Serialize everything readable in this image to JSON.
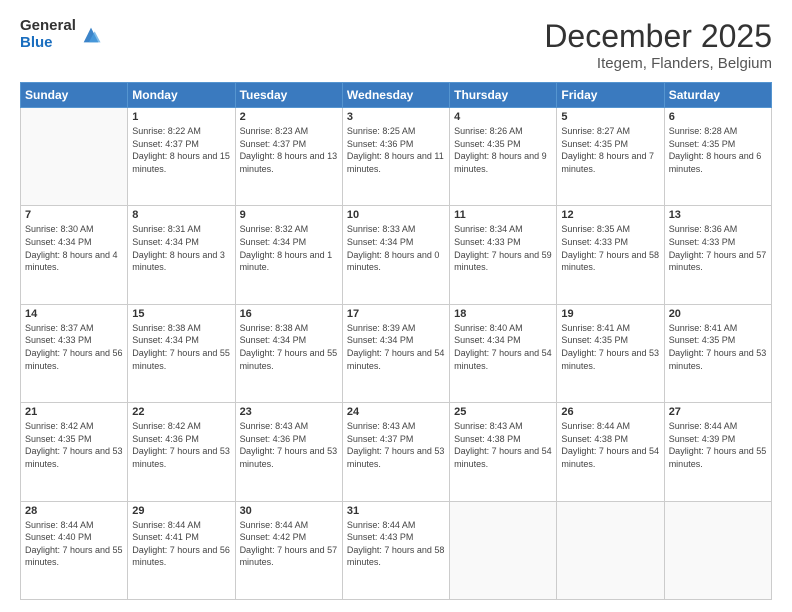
{
  "logo": {
    "general": "General",
    "blue": "Blue"
  },
  "header": {
    "month": "December 2025",
    "location": "Itegem, Flanders, Belgium"
  },
  "days": [
    "Sunday",
    "Monday",
    "Tuesday",
    "Wednesday",
    "Thursday",
    "Friday",
    "Saturday"
  ],
  "weeks": [
    [
      {
        "day": "",
        "sunrise": "",
        "sunset": "",
        "daylight": ""
      },
      {
        "day": "1",
        "sunrise": "Sunrise: 8:22 AM",
        "sunset": "Sunset: 4:37 PM",
        "daylight": "Daylight: 8 hours and 15 minutes."
      },
      {
        "day": "2",
        "sunrise": "Sunrise: 8:23 AM",
        "sunset": "Sunset: 4:37 PM",
        "daylight": "Daylight: 8 hours and 13 minutes."
      },
      {
        "day": "3",
        "sunrise": "Sunrise: 8:25 AM",
        "sunset": "Sunset: 4:36 PM",
        "daylight": "Daylight: 8 hours and 11 minutes."
      },
      {
        "day": "4",
        "sunrise": "Sunrise: 8:26 AM",
        "sunset": "Sunset: 4:35 PM",
        "daylight": "Daylight: 8 hours and 9 minutes."
      },
      {
        "day": "5",
        "sunrise": "Sunrise: 8:27 AM",
        "sunset": "Sunset: 4:35 PM",
        "daylight": "Daylight: 8 hours and 7 minutes."
      },
      {
        "day": "6",
        "sunrise": "Sunrise: 8:28 AM",
        "sunset": "Sunset: 4:35 PM",
        "daylight": "Daylight: 8 hours and 6 minutes."
      }
    ],
    [
      {
        "day": "7",
        "sunrise": "Sunrise: 8:30 AM",
        "sunset": "Sunset: 4:34 PM",
        "daylight": "Daylight: 8 hours and 4 minutes."
      },
      {
        "day": "8",
        "sunrise": "Sunrise: 8:31 AM",
        "sunset": "Sunset: 4:34 PM",
        "daylight": "Daylight: 8 hours and 3 minutes."
      },
      {
        "day": "9",
        "sunrise": "Sunrise: 8:32 AM",
        "sunset": "Sunset: 4:34 PM",
        "daylight": "Daylight: 8 hours and 1 minute."
      },
      {
        "day": "10",
        "sunrise": "Sunrise: 8:33 AM",
        "sunset": "Sunset: 4:34 PM",
        "daylight": "Daylight: 8 hours and 0 minutes."
      },
      {
        "day": "11",
        "sunrise": "Sunrise: 8:34 AM",
        "sunset": "Sunset: 4:33 PM",
        "daylight": "Daylight: 7 hours and 59 minutes."
      },
      {
        "day": "12",
        "sunrise": "Sunrise: 8:35 AM",
        "sunset": "Sunset: 4:33 PM",
        "daylight": "Daylight: 7 hours and 58 minutes."
      },
      {
        "day": "13",
        "sunrise": "Sunrise: 8:36 AM",
        "sunset": "Sunset: 4:33 PM",
        "daylight": "Daylight: 7 hours and 57 minutes."
      }
    ],
    [
      {
        "day": "14",
        "sunrise": "Sunrise: 8:37 AM",
        "sunset": "Sunset: 4:33 PM",
        "daylight": "Daylight: 7 hours and 56 minutes."
      },
      {
        "day": "15",
        "sunrise": "Sunrise: 8:38 AM",
        "sunset": "Sunset: 4:34 PM",
        "daylight": "Daylight: 7 hours and 55 minutes."
      },
      {
        "day": "16",
        "sunrise": "Sunrise: 8:38 AM",
        "sunset": "Sunset: 4:34 PM",
        "daylight": "Daylight: 7 hours and 55 minutes."
      },
      {
        "day": "17",
        "sunrise": "Sunrise: 8:39 AM",
        "sunset": "Sunset: 4:34 PM",
        "daylight": "Daylight: 7 hours and 54 minutes."
      },
      {
        "day": "18",
        "sunrise": "Sunrise: 8:40 AM",
        "sunset": "Sunset: 4:34 PM",
        "daylight": "Daylight: 7 hours and 54 minutes."
      },
      {
        "day": "19",
        "sunrise": "Sunrise: 8:41 AM",
        "sunset": "Sunset: 4:35 PM",
        "daylight": "Daylight: 7 hours and 53 minutes."
      },
      {
        "day": "20",
        "sunrise": "Sunrise: 8:41 AM",
        "sunset": "Sunset: 4:35 PM",
        "daylight": "Daylight: 7 hours and 53 minutes."
      }
    ],
    [
      {
        "day": "21",
        "sunrise": "Sunrise: 8:42 AM",
        "sunset": "Sunset: 4:35 PM",
        "daylight": "Daylight: 7 hours and 53 minutes."
      },
      {
        "day": "22",
        "sunrise": "Sunrise: 8:42 AM",
        "sunset": "Sunset: 4:36 PM",
        "daylight": "Daylight: 7 hours and 53 minutes."
      },
      {
        "day": "23",
        "sunrise": "Sunrise: 8:43 AM",
        "sunset": "Sunset: 4:36 PM",
        "daylight": "Daylight: 7 hours and 53 minutes."
      },
      {
        "day": "24",
        "sunrise": "Sunrise: 8:43 AM",
        "sunset": "Sunset: 4:37 PM",
        "daylight": "Daylight: 7 hours and 53 minutes."
      },
      {
        "day": "25",
        "sunrise": "Sunrise: 8:43 AM",
        "sunset": "Sunset: 4:38 PM",
        "daylight": "Daylight: 7 hours and 54 minutes."
      },
      {
        "day": "26",
        "sunrise": "Sunrise: 8:44 AM",
        "sunset": "Sunset: 4:38 PM",
        "daylight": "Daylight: 7 hours and 54 minutes."
      },
      {
        "day": "27",
        "sunrise": "Sunrise: 8:44 AM",
        "sunset": "Sunset: 4:39 PM",
        "daylight": "Daylight: 7 hours and 55 minutes."
      }
    ],
    [
      {
        "day": "28",
        "sunrise": "Sunrise: 8:44 AM",
        "sunset": "Sunset: 4:40 PM",
        "daylight": "Daylight: 7 hours and 55 minutes."
      },
      {
        "day": "29",
        "sunrise": "Sunrise: 8:44 AM",
        "sunset": "Sunset: 4:41 PM",
        "daylight": "Daylight: 7 hours and 56 minutes."
      },
      {
        "day": "30",
        "sunrise": "Sunrise: 8:44 AM",
        "sunset": "Sunset: 4:42 PM",
        "daylight": "Daylight: 7 hours and 57 minutes."
      },
      {
        "day": "31",
        "sunrise": "Sunrise: 8:44 AM",
        "sunset": "Sunset: 4:43 PM",
        "daylight": "Daylight: 7 hours and 58 minutes."
      },
      {
        "day": "",
        "sunrise": "",
        "sunset": "",
        "daylight": ""
      },
      {
        "day": "",
        "sunrise": "",
        "sunset": "",
        "daylight": ""
      },
      {
        "day": "",
        "sunrise": "",
        "sunset": "",
        "daylight": ""
      }
    ]
  ]
}
